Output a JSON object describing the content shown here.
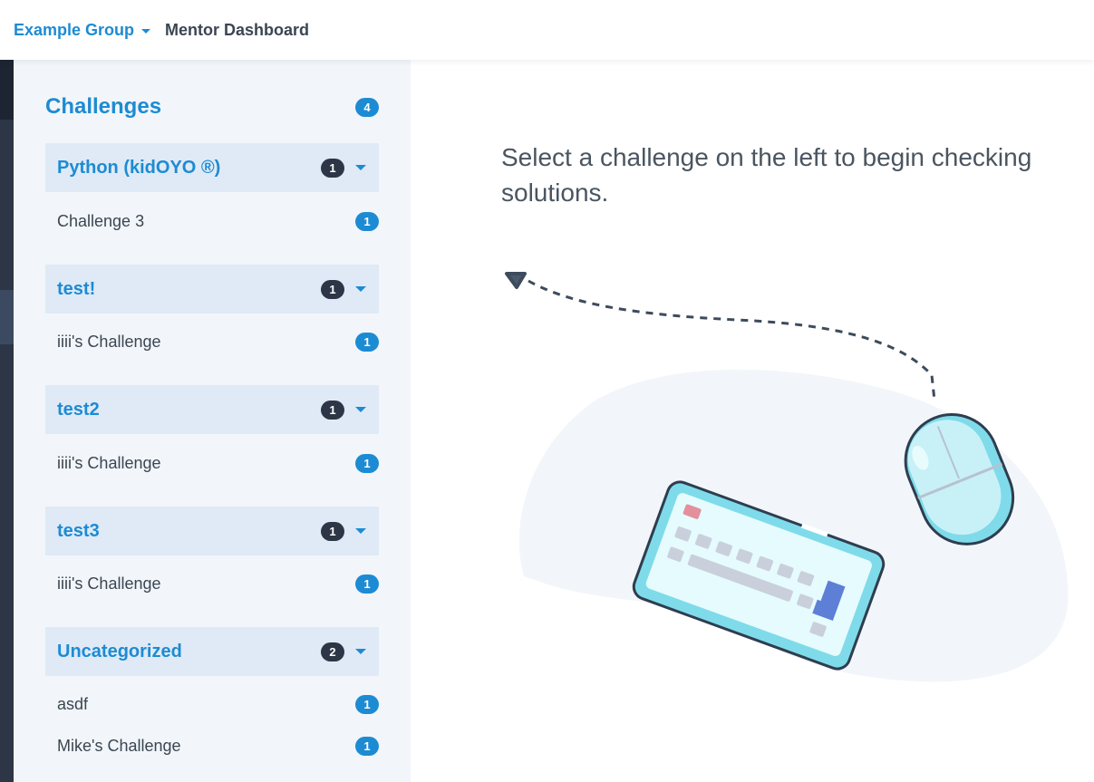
{
  "header": {
    "group_name": "Example Group",
    "dashboard_title": "Mentor Dashboard"
  },
  "sidebar": {
    "title": "Challenges",
    "total_count": "4",
    "categories": [
      {
        "name": "Python (kidOYO ®)",
        "count": "1",
        "items": [
          {
            "label": "Challenge 3",
            "count": "1"
          }
        ]
      },
      {
        "name": "test!",
        "count": "1",
        "items": [
          {
            "label": "iiii's Challenge",
            "count": "1"
          }
        ]
      },
      {
        "name": "test2",
        "count": "1",
        "items": [
          {
            "label": "iiii's Challenge",
            "count": "1"
          }
        ]
      },
      {
        "name": "test3",
        "count": "1",
        "items": [
          {
            "label": "iiii's Challenge",
            "count": "1"
          }
        ]
      },
      {
        "name": "Uncategorized",
        "count": "2",
        "items": [
          {
            "label": "asdf",
            "count": "1"
          },
          {
            "label": "Mike's Challenge",
            "count": "1"
          }
        ]
      }
    ]
  },
  "main": {
    "prompt": "Select a challenge on the left to begin checking solutions."
  },
  "colors": {
    "accent": "#1d8bd3",
    "dark_badge": "#2c3646",
    "sidebar_bg": "#f2f6fa",
    "category_bg": "#dfeaf6"
  },
  "icons": {
    "group_caret": "caret-down-icon",
    "category_chevron": "chevron-down-icon",
    "illustration": [
      "cursor-icon",
      "keyboard-icon",
      "mouse-icon"
    ]
  }
}
